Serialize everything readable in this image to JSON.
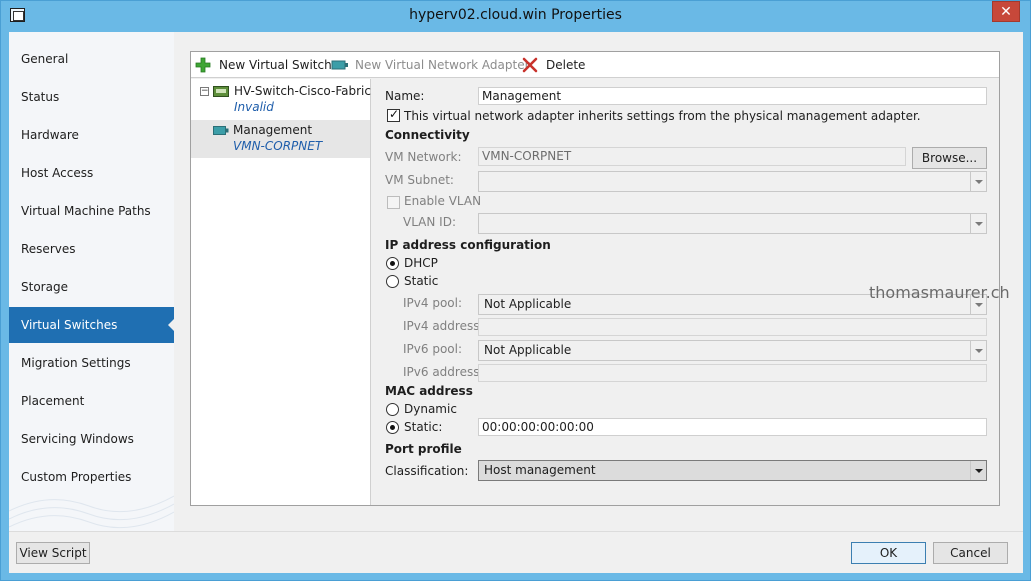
{
  "window": {
    "title": "hyperv02.cloud.win Properties",
    "close_glyph": "✕"
  },
  "sidebar": {
    "items": [
      {
        "label": "General"
      },
      {
        "label": "Status"
      },
      {
        "label": "Hardware"
      },
      {
        "label": "Host Access"
      },
      {
        "label": "Virtual Machine Paths"
      },
      {
        "label": "Reserves"
      },
      {
        "label": "Storage"
      },
      {
        "label": "Virtual Switches",
        "active": true
      },
      {
        "label": "Migration Settings"
      },
      {
        "label": "Placement"
      },
      {
        "label": "Servicing Windows"
      },
      {
        "label": "Custom Properties"
      }
    ]
  },
  "toolbar": {
    "new_switch": "New Virtual Switch",
    "new_adapter": "New Virtual Network Adapter",
    "delete": "Delete"
  },
  "tree": {
    "switch": {
      "name": "HV-Switch-Cisco-Fabric",
      "status": "Invalid",
      "expander": "−"
    },
    "adapter": {
      "name": "Management",
      "network": "VMN-CORPNET"
    }
  },
  "details": {
    "name_label": "Name:",
    "name_value": "Management",
    "inherit_label": "This virtual network adapter inherits settings from the physical management adapter.",
    "inherit_checked": true,
    "connectivity": {
      "heading": "Connectivity",
      "vm_network_label": "VM Network:",
      "vm_network_value": "VMN-CORPNET",
      "browse": "Browse...",
      "vm_subnet_label": "VM Subnet:",
      "vm_subnet_value": "",
      "enable_vlan_label": "Enable VLAN",
      "vlan_id_label": "VLAN ID:",
      "vlan_id_value": ""
    },
    "ip": {
      "heading": "IP address configuration",
      "dhcp_label": "DHCP",
      "static_label": "Static",
      "selected": "DHCP",
      "ipv4_pool_label": "IPv4 pool:",
      "ipv4_pool_value": "Not Applicable",
      "ipv4_address_label": "IPv4 address:",
      "ipv6_pool_label": "IPv6 pool:",
      "ipv6_pool_value": "Not Applicable",
      "ipv6_address_label": "IPv6 address:"
    },
    "mac": {
      "heading": "MAC address",
      "dynamic_label": "Dynamic",
      "static_label": "Static:",
      "selected": "Static",
      "static_value": "00:00:00:00:00:00"
    },
    "port_profile": {
      "heading": "Port profile",
      "classification_label": "Classification:",
      "classification_value": "Host management"
    }
  },
  "watermark": "thomasmaurer.ch",
  "footer": {
    "view_script": "View Script",
    "ok": "OK",
    "cancel": "Cancel"
  },
  "colors": {
    "chrome": "#6ab9e6",
    "nav_active": "#1f6fb2",
    "link_italic": "#1f5eab"
  }
}
